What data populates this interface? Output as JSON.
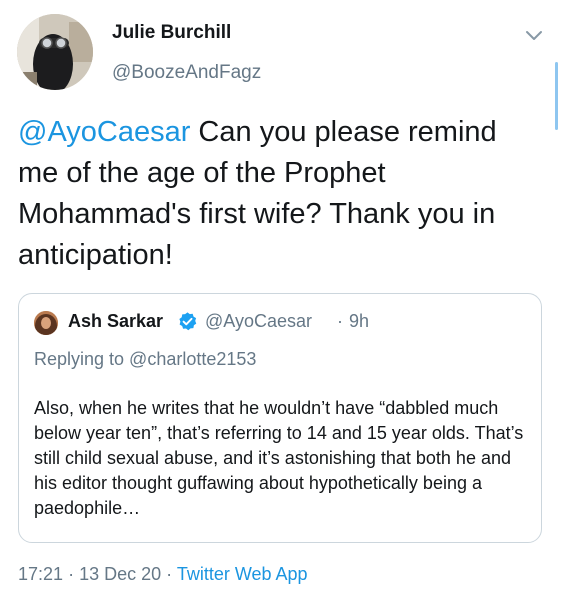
{
  "tweet": {
    "author_name": "Julie Burchill",
    "author_handle": "@BoozeAndFagz",
    "mention": "@AyoCaesar",
    "body": " Can you please remind me of the age of the Prophet Mohammad's first wife? Thank you in anticipation!",
    "time": "17:21",
    "date": "13 Dec 20",
    "source": "Twitter Web App",
    "separator": "·"
  },
  "quoted_tweet": {
    "author_name": "Ash Sarkar",
    "author_handle": "@AyoCaesar",
    "separator": "·",
    "age": "9h",
    "replying_to": "Replying to @charlotte2153",
    "text": "Also, when he writes that he wouldn’t have “dabbled much below year ten”, that’s referring to 14 and 15 year olds. That’s still child sexual abuse, and it’s astonishing that both he and his editor thought guffawing about hypothetically being a paedophile…"
  },
  "colors": {
    "link": "#1b95e0",
    "secondary_text": "#657786",
    "primary_text": "#14171a",
    "border": "#ccd6dd"
  },
  "icons": {
    "caret": "chevron-down-icon",
    "verified": "verified-badge-icon"
  }
}
